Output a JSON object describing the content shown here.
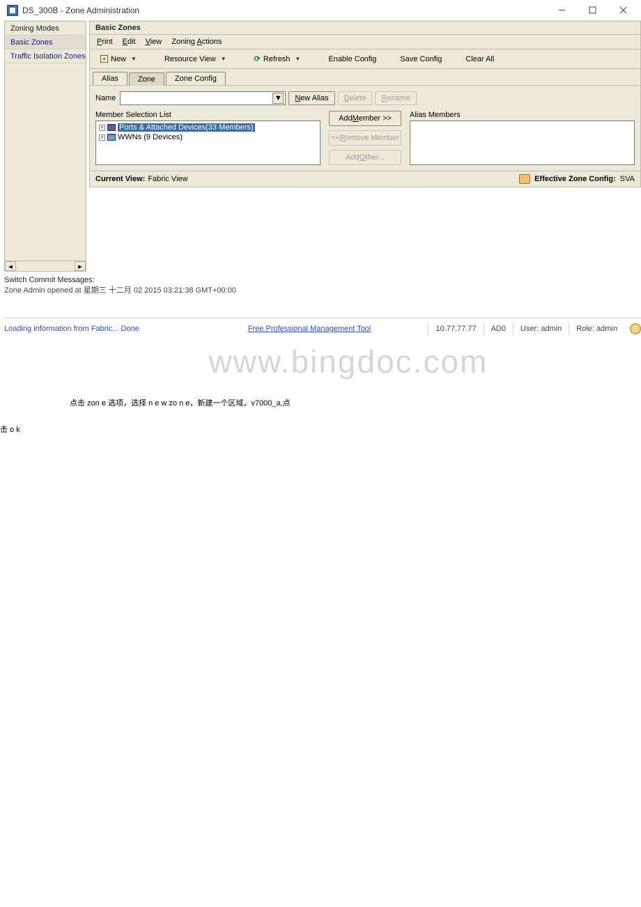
{
  "window": {
    "title": "DS_300B - Zone Administration"
  },
  "sidebar": {
    "items": [
      {
        "label": "Zoning Modes",
        "header": true
      },
      {
        "label": "Basic Zones",
        "selected": true
      },
      {
        "label": "Traffic Isolation Zones"
      }
    ]
  },
  "panel": {
    "title": "Basic Zones"
  },
  "menus": [
    {
      "label": "Print",
      "ul": "P"
    },
    {
      "label": "Edit",
      "ul": "E"
    },
    {
      "label": "View",
      "ul": "V"
    },
    {
      "label": "Zoning Actions",
      "ul": "A"
    }
  ],
  "toolbar": {
    "new": "New",
    "resource_view": "Resource View",
    "refresh": "Refresh",
    "enable_config": "Enable Config",
    "save_config": "Save Config",
    "clear_all": "Clear All"
  },
  "tabs": [
    {
      "label": "Alias",
      "active": false
    },
    {
      "label": "Zone",
      "active": true
    },
    {
      "label": "Zone Config",
      "active": false
    }
  ],
  "name_row": {
    "label": "Name",
    "new_alias": "New Alias",
    "new_ul": "N",
    "delete": "Delete",
    "delete_ul": "D",
    "rename": "Rename",
    "rename_ul": "R"
  },
  "left_list": {
    "title": "Member Selection List",
    "items": [
      {
        "label": "Ports & Attached Devices(33 Members)",
        "selected": true,
        "icon": "ports"
      },
      {
        "label": "WWNs (9 Devices)",
        "icon": "wwn"
      }
    ]
  },
  "center_buttons": {
    "add_member": "Add Member >>",
    "remove_member": "<< Remove Member",
    "add_other": "Add Other..."
  },
  "right_list": {
    "title": "Alias Members"
  },
  "panel_footer": {
    "label": "Current View:",
    "value": "Fabric View",
    "right_label": "Effective Zone Config:",
    "right_value": "SVA"
  },
  "messages": {
    "title": "Switch Commit Messages:",
    "line": "Zone Admin opened at 星期三 十二月 02 2015 03:21:38 GMT+00:00"
  },
  "statusbar": {
    "loading": "Loading information from Fabric... Done",
    "mgmt_link": "Free Professional Management Tool",
    "ip": "10.77.77.77",
    "ad": "AD0",
    "user": "User: admin",
    "role": "Role: admin"
  },
  "watermark": "www.bingdoc.com",
  "instruction": {
    "line1": "点击 zon e 选项，选择 n e w zo n e，新建一个区域，v7000_a,点",
    "line2": "击 o  k"
  }
}
